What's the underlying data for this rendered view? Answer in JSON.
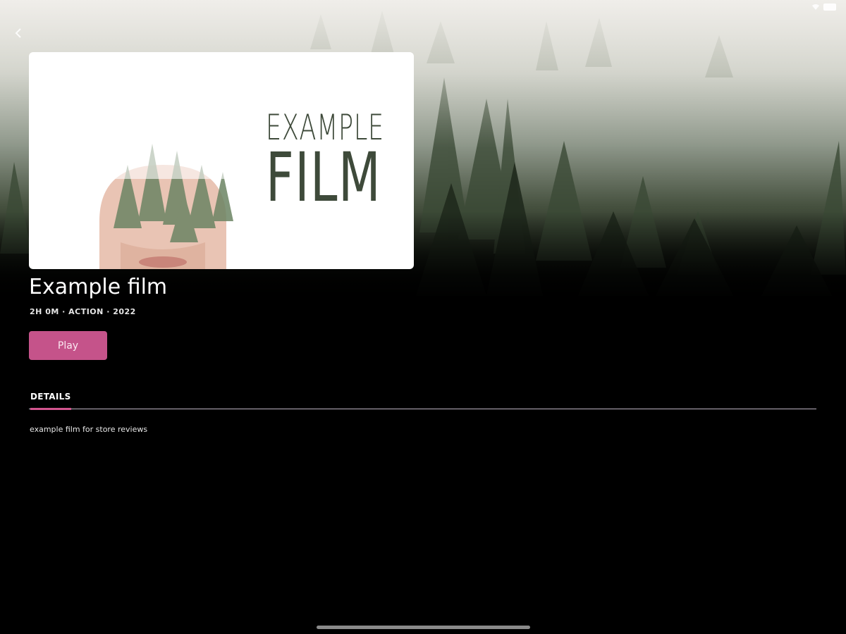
{
  "status_bar": {
    "battery_text": "",
    "icons": [
      "wifi-icon",
      "battery-icon"
    ]
  },
  "navigation": {
    "back_icon": "chevron-left-icon"
  },
  "poster": {
    "title_line1": "EXAMPLE",
    "title_line2": "FILM"
  },
  "film": {
    "title": "Example film",
    "meta": "2H 0M · ACTION · 2022"
  },
  "actions": {
    "play_label": "Play"
  },
  "tabs": [
    {
      "label": "DETAILS",
      "active": true
    }
  ],
  "details": {
    "description": "example film for store reviews"
  },
  "colors": {
    "accent": "#c5538a",
    "tab_indicator": "#d3558f",
    "background": "#000000"
  }
}
